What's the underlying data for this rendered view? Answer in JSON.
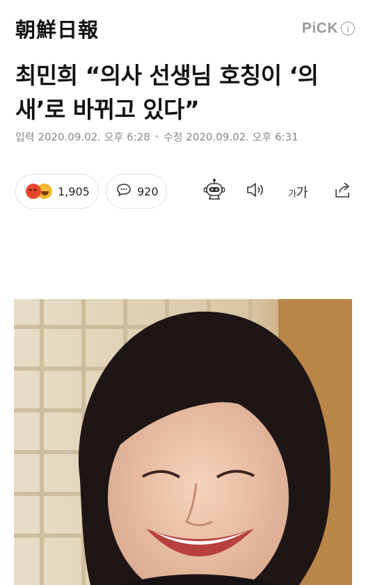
{
  "header": {
    "logo_text": "朝鮮日報",
    "pick_label": "PiCK",
    "info_glyph": "i"
  },
  "article": {
    "headline": "최민희 “의사 선생님 호칭이 ‘의새’로 바뀌고 있다”",
    "published_label": "입력 2020.09.02. 오후 6:28",
    "modified_label": "수정 2020.09.02. 오후 6:31"
  },
  "actions": {
    "reaction_count": "1,905",
    "comment_count": "920",
    "font_size_label_small": "가",
    "font_size_label_large": "가"
  },
  "icons": {
    "reaction_emojis": [
      "angry-face-icon",
      "laughing-face-icon"
    ],
    "comment": "speech-bubble-icon",
    "summary_bot": "robot-icon",
    "audio": "speaker-icon",
    "share": "share-icon"
  },
  "colors": {
    "text": "#111111",
    "muted": "#888888",
    "pick": "#9a9a9a",
    "pill_border": "#e2e2e2"
  }
}
